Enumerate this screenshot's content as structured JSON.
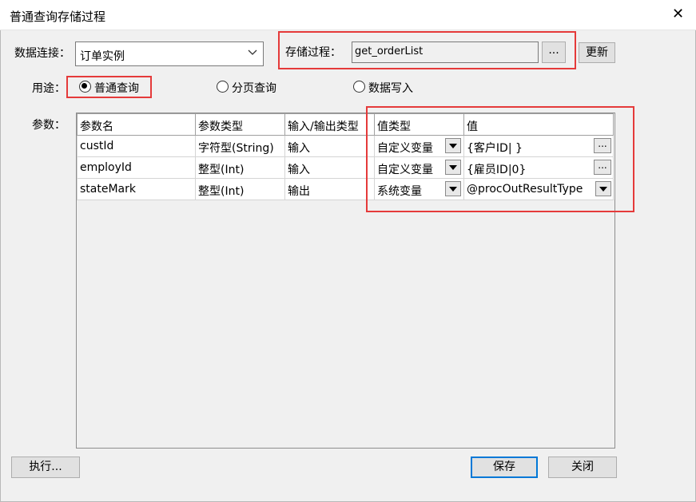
{
  "window": {
    "title": "普通查询存储过程",
    "close_glyph": "✕"
  },
  "connection": {
    "label": "数据连接：",
    "value": "订单实例"
  },
  "procedure": {
    "label": "存储过程：",
    "value": "get_orderList",
    "browse_label": "...",
    "refresh_label": "更新"
  },
  "usage": {
    "label": "用途：",
    "options": [
      {
        "label": "普通查询",
        "selected": true
      },
      {
        "label": "分页查询",
        "selected": false
      },
      {
        "label": "数据写入",
        "selected": false
      }
    ]
  },
  "params": {
    "label": "参数：",
    "columns": [
      "参数名",
      "参数类型",
      "输入/输出类型",
      "值类型",
      "值"
    ],
    "rows": [
      {
        "name": "custId",
        "type": "字符型(String)",
        "io": "输入",
        "value_type": "自定义变量",
        "value": "{客户ID| }",
        "value_has_dropdown": false
      },
      {
        "name": "employId",
        "type": "整型(Int)",
        "io": "输入",
        "value_type": "自定义变量",
        "value": "{雇员ID|0}",
        "value_has_dropdown": false
      },
      {
        "name": "stateMark",
        "type": "整型(Int)",
        "io": "输出",
        "value_type": "系统变量",
        "value": "@procOutResultType",
        "value_has_dropdown": true
      }
    ],
    "cell_button_label": "..."
  },
  "footer": {
    "execute_label": "执行...",
    "save_label": "保存",
    "close_label": "关闭"
  },
  "colors": {
    "highlight_red": "#e53a3a",
    "focus_blue": "#0078d7"
  }
}
